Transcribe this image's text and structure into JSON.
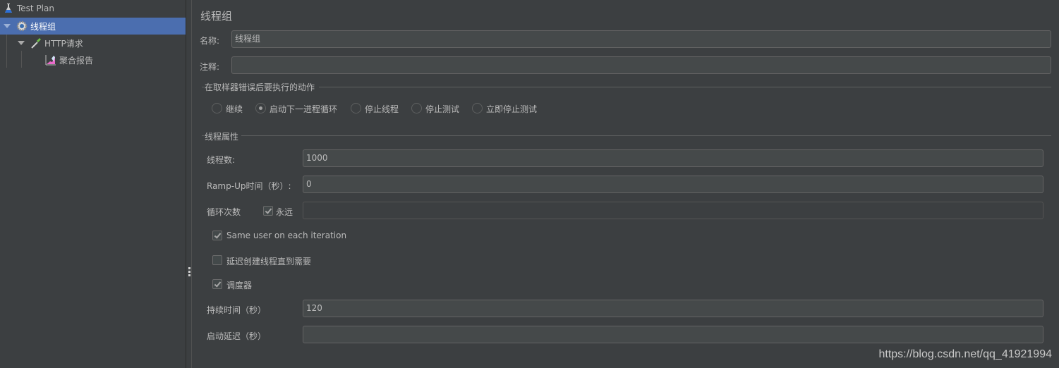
{
  "tree": {
    "items": [
      {
        "label": "Test Plan",
        "icon": "flask-icon"
      },
      {
        "label": "线程组",
        "icon": "gear-icon",
        "selected": true
      },
      {
        "label": "HTTP请求",
        "icon": "pipette-icon"
      },
      {
        "label": "聚合报告",
        "icon": "chart-icon"
      }
    ]
  },
  "panel": {
    "title": "线程组",
    "name_label": "名称:",
    "name_value": "线程组",
    "comment_label": "注释:",
    "comment_value": "",
    "error_action": {
      "legend": "在取样器错误后要执行的动作",
      "options": [
        {
          "label": "继续",
          "checked": false
        },
        {
          "label": "启动下一进程循环",
          "checked": true
        },
        {
          "label": "停止线程",
          "checked": false
        },
        {
          "label": "停止测试",
          "checked": false
        },
        {
          "label": "立即停止测试",
          "checked": false
        }
      ]
    },
    "thread_props": {
      "legend": "线程属性",
      "threads_label": "线程数:",
      "threads_value": "1000",
      "rampup_label": "Ramp-Up时间（秒）:",
      "rampup_value": "0",
      "loop_label": "循环次数",
      "forever_label": "永远",
      "forever_checked": true,
      "loop_value": "",
      "same_user_label": "Same user on each iteration",
      "same_user_checked": true,
      "delay_create_label": "延迟创建线程直到需要",
      "delay_create_checked": false,
      "scheduler_label": "调度器",
      "scheduler_checked": true,
      "duration_label": "持续时间（秒）",
      "duration_value": "120",
      "startup_delay_label": "启动延迟（秒）",
      "startup_delay_value": ""
    }
  },
  "watermark": "https://blog.csdn.net/qq_41921994"
}
